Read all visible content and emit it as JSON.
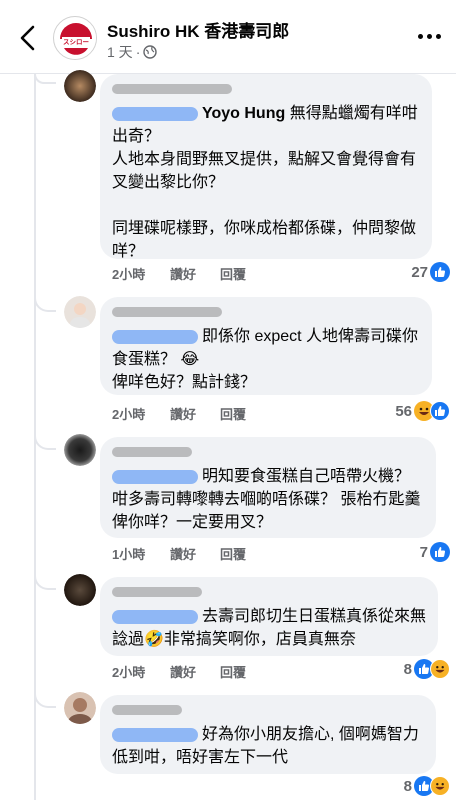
{
  "header": {
    "page_name": "Sushiro HK 香港壽司郎",
    "time": "1 天",
    "logo_text": "スシロー",
    "brand_color": "#c8102e"
  },
  "comments": [
    {
      "text": "Yoyo Hung 無得點蠟燭有咩咁出奇？\n人地本身間野無叉提供，點解又會覺得會有叉變出黎比你？\n\n同埋碟呢樣野，你咪成枱都係碟，仲問黎做咩？",
      "mention_prefix": "Yoyo Hung",
      "time": "2小時",
      "like": "讚好",
      "reply": "回覆",
      "reaction_count": "27",
      "reactions": [
        "like-icon"
      ]
    },
    {
      "text": "即係你 expect 人地俾壽司碟你食蛋糕？ 😂\n俾咩色好？點計錢？",
      "time": "2小時",
      "like": "讚好",
      "reply": "回覆",
      "reaction_count": "56",
      "reactions": [
        "haha-icon",
        "like-icon"
      ]
    },
    {
      "text": "明知要食蛋糕自己唔帶火機？ 咁多壽司轉嚟轉去嗰啲唔係碟？ 張枱冇匙羹俾你咩？一定要用叉？",
      "time": "1小時",
      "like": "讚好",
      "reply": "回覆",
      "reaction_count": "7",
      "reactions": [
        "like-icon"
      ]
    },
    {
      "text": "去壽司郎切生日蛋糕真係從來無諗過🤣非常搞笑啊你，店員真無奈",
      "time": "2小時",
      "like": "讚好",
      "reply": "回覆",
      "reaction_count": "8",
      "reactions": [
        "like-icon",
        "haha-icon"
      ]
    },
    {
      "text": "好為你小朋友擔心, 個啊媽智力低到咁，唔好害左下一代",
      "time": "2小時",
      "like": "讚好",
      "reply": "回覆",
      "reaction_count": "8",
      "reactions": [
        "like-icon",
        "haha-icon"
      ]
    }
  ]
}
